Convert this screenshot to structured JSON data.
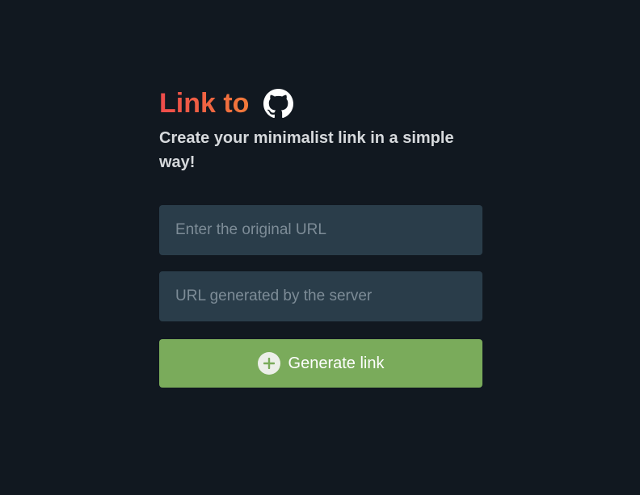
{
  "header": {
    "title": "Link to",
    "github_icon": "github-icon",
    "subtitle": "Create your minimalist link in a simple way!"
  },
  "form": {
    "original_url": {
      "value": "",
      "placeholder": "Enter the original URL"
    },
    "generated_url": {
      "value": "",
      "placeholder": "URL generated by the server"
    },
    "generate_button": {
      "label": "Generate link",
      "icon": "plus-circle-icon"
    }
  },
  "colors": {
    "background": "#111820",
    "title_gradient_start": "#ef4b4b",
    "title_gradient_end": "#f07a3a",
    "input_background": "#2a3d4a",
    "button_background": "#7aab5b"
  }
}
